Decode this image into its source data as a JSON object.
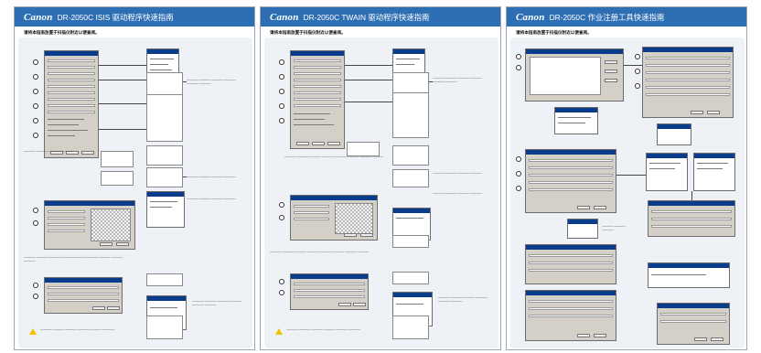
{
  "panels": [
    {
      "brand": "Canon",
      "title": "DR-2050C ISIS 驱动程序快速指南",
      "subtitle": "请将本指南放置于扫描仪附近以便查阅。"
    },
    {
      "brand": "Canon",
      "title": "DR-2050C TWAIN 驱动程序快速指南",
      "subtitle": "请将本指南放置于扫描仪附近以便查阅。"
    },
    {
      "brand": "Canon",
      "title": "DR-2050C 作业注册工具快速指南",
      "subtitle": "请将本指南放置于扫描仪附近以便查阅。"
    }
  ],
  "colors": {
    "header": "#2e6fb4",
    "background": "#eef1f5",
    "dialog": "#d4d0c8",
    "titlebar": "#0a3c8c",
    "warning": "#f2c200"
  },
  "icons": [
    "warning-icon"
  ]
}
